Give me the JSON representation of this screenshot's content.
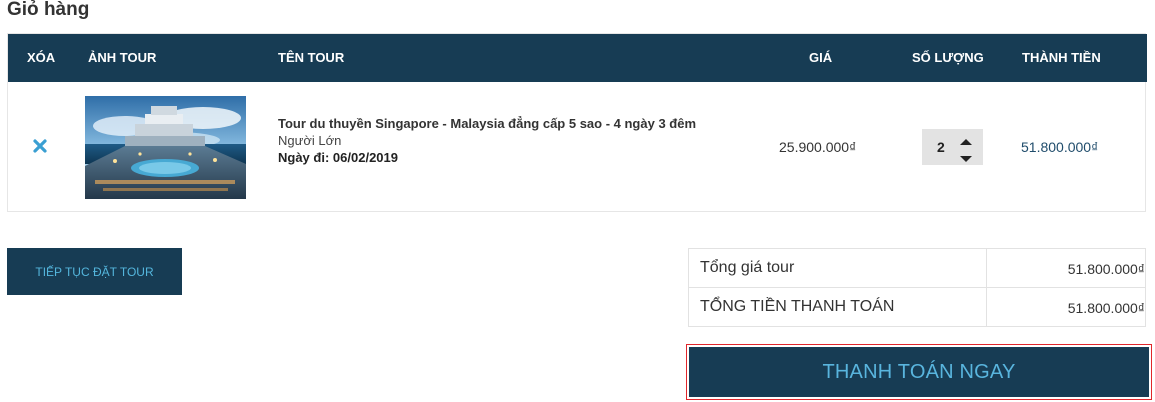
{
  "page": {
    "title": "Giỏ hàng"
  },
  "cart": {
    "headers": {
      "delete": "XÓA",
      "image": "ẢNH TOUR",
      "name": "TÊN TOUR",
      "price": "GIÁ",
      "quantity": "SỐ LƯỢNG",
      "total": "THÀNH TIỀN"
    },
    "items": [
      {
        "name": "Tour du thuyền Singapore - Malaysia đẳng cấp 5 sao - 4 ngày 3 đêm",
        "type": "Người Lớn",
        "date_label": "Ngày đi:",
        "date": "06/02/2019",
        "price": "25.900.000₫",
        "quantity": "2",
        "total": "51.800.000₫"
      }
    ]
  },
  "actions": {
    "continue_label": "TIẾP TỤC ĐẶT TOUR",
    "pay_label": "THANH TOÁN NGAY"
  },
  "summary": {
    "subtotal_label": "Tổng giá tour",
    "subtotal_value": "51.800.000₫",
    "grand_total_label": "TỔNG TIỀN THANH TOÁN",
    "grand_total_value": "51.800.000₫"
  },
  "icons": {
    "delete": "close-icon",
    "qty_up": "caret-up-icon",
    "qty_down": "caret-down-icon"
  },
  "colors": {
    "header_bg": "#173c54",
    "accent": "#59b5de",
    "delete_icon": "#3a9fd2",
    "highlight_border": "#e0262b"
  }
}
